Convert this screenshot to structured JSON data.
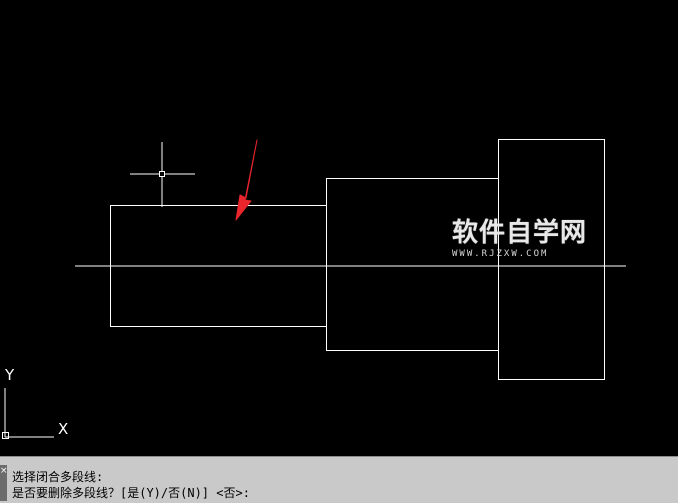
{
  "watermark": {
    "title": "软件自学网",
    "url": "WWW.RJZXW.COM"
  },
  "ucs": {
    "y_label": "Y",
    "x_label": "X"
  },
  "command": {
    "grip_glyph": "×",
    "history_line": "选择闭合多段线:",
    "prompt_line": "是否要删除多段线？[是(Y)/否(N)] <否>:"
  },
  "colors": {
    "canvas_background": "#000000",
    "line_color": "#ffffff",
    "arrow_color": "#e8262c",
    "command_bar_background": "#c9c9c9"
  }
}
